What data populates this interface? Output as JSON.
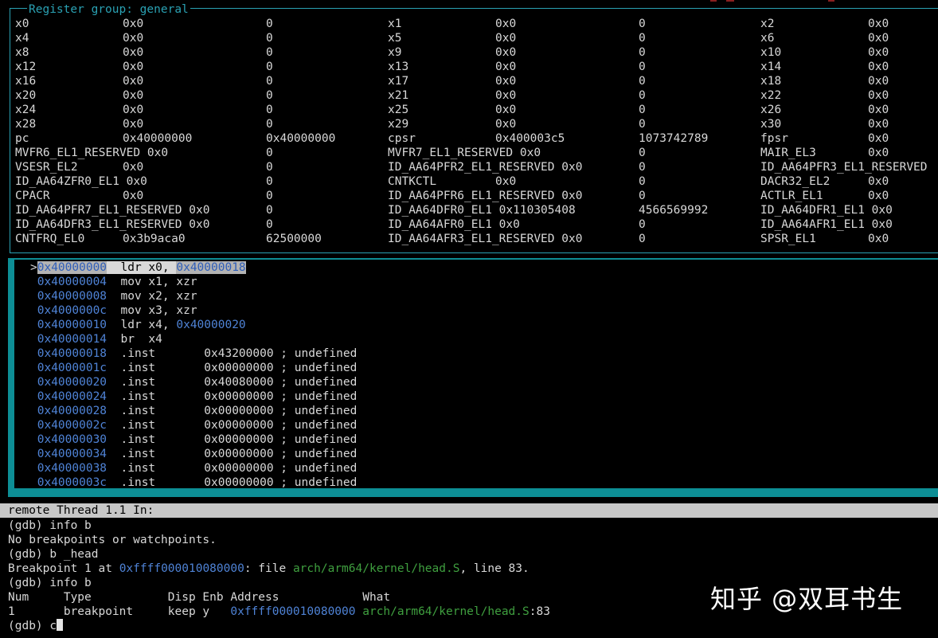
{
  "registers": {
    "title": "Register group: general",
    "rows": [
      [
        [
          "x0",
          "0x0",
          "0"
        ],
        [
          "x1",
          "0x0",
          "0"
        ],
        [
          "x2",
          "0x0",
          ""
        ]
      ],
      [
        [
          "x4",
          "0x0",
          "0"
        ],
        [
          "x5",
          "0x0",
          "0"
        ],
        [
          "x6",
          "0x0",
          ""
        ]
      ],
      [
        [
          "x8",
          "0x0",
          "0"
        ],
        [
          "x9",
          "0x0",
          "0"
        ],
        [
          "x10",
          "0x0",
          ""
        ]
      ],
      [
        [
          "x12",
          "0x0",
          "0"
        ],
        [
          "x13",
          "0x0",
          "0"
        ],
        [
          "x14",
          "0x0",
          ""
        ]
      ],
      [
        [
          "x16",
          "0x0",
          "0"
        ],
        [
          "x17",
          "0x0",
          "0"
        ],
        [
          "x18",
          "0x0",
          ""
        ]
      ],
      [
        [
          "x20",
          "0x0",
          "0"
        ],
        [
          "x21",
          "0x0",
          "0"
        ],
        [
          "x22",
          "0x0",
          ""
        ]
      ],
      [
        [
          "x24",
          "0x0",
          "0"
        ],
        [
          "x25",
          "0x0",
          "0"
        ],
        [
          "x26",
          "0x0",
          ""
        ]
      ],
      [
        [
          "x28",
          "0x0",
          "0"
        ],
        [
          "x29",
          "0x0",
          "0"
        ],
        [
          "x30",
          "0x0",
          ""
        ]
      ],
      [
        [
          "pc",
          "0x40000000",
          "0x40000000"
        ],
        [
          "cpsr",
          "0x400003c5",
          "1073742789"
        ],
        [
          "fpsr",
          "0x0",
          ""
        ]
      ],
      [
        [
          "MVFR6_EL1_RESERVED 0x0",
          "",
          "0"
        ],
        [
          "MVFR7_EL1_RESERVED 0x0",
          "",
          "0"
        ],
        [
          "MAIR_EL3",
          "0x0",
          ""
        ]
      ],
      [
        [
          "VSESR_EL2",
          "0x0",
          "0"
        ],
        [
          "ID_AA64PFR2_EL1_RESERVED 0x0",
          "",
          "0"
        ],
        [
          "ID_AA64PFR3_EL1_RESERVED",
          "",
          ""
        ]
      ],
      [
        [
          "ID_AA64ZFR0_EL1 0x0",
          "",
          "0"
        ],
        [
          "CNTKCTL",
          "0x0",
          "0"
        ],
        [
          "DACR32_EL2",
          "0x0",
          ""
        ]
      ],
      [
        [
          "CPACR",
          "0x0",
          "0"
        ],
        [
          "ID_AA64PFR6_EL1_RESERVED 0x0",
          "",
          "0"
        ],
        [
          "ACTLR_EL1",
          "0x0",
          ""
        ]
      ],
      [
        [
          "ID_AA64PFR7_EL1_RESERVED 0x0",
          "",
          "0"
        ],
        [
          "ID_AA64DFR0_EL1 0x110305408",
          "",
          "4566569992"
        ],
        [
          "ID_AA64DFR1_EL1 0x0",
          "",
          ""
        ]
      ],
      [
        [
          "ID_AA64DFR3_EL1_RESERVED 0x0",
          "",
          "0"
        ],
        [
          "ID_AA64AFR0_EL1 0x0",
          "",
          "0"
        ],
        [
          "ID_AA64AFR1_EL1 0x0",
          "",
          ""
        ]
      ],
      [
        [
          "CNTFRQ_EL0",
          "0x3b9aca0",
          "62500000"
        ],
        [
          "ID_AA64AFR3_EL1_RESERVED 0x0",
          "",
          "0"
        ],
        [
          "SPSR_EL1",
          "0x0",
          ""
        ]
      ]
    ]
  },
  "disassembly": {
    "current_marker": ">",
    "lines": [
      {
        "addr": "0x40000000",
        "ins": "ldr x0, ",
        "operand": "0x40000018",
        "current": true
      },
      {
        "addr": "0x40000004",
        "ins": "mov x1, xzr",
        "operand": ""
      },
      {
        "addr": "0x40000008",
        "ins": "mov x2, xzr",
        "operand": ""
      },
      {
        "addr": "0x4000000c",
        "ins": "mov x3, xzr",
        "operand": ""
      },
      {
        "addr": "0x40000010",
        "ins": "ldr x4, ",
        "operand": "0x40000020"
      },
      {
        "addr": "0x40000014",
        "ins": "br  x4",
        "operand": ""
      },
      {
        "addr": "0x40000018",
        "ins": ".inst       0x43200000 ; undefined",
        "operand": ""
      },
      {
        "addr": "0x4000001c",
        "ins": ".inst       0x00000000 ; undefined",
        "operand": ""
      },
      {
        "addr": "0x40000020",
        "ins": ".inst       0x40080000 ; undefined",
        "operand": ""
      },
      {
        "addr": "0x40000024",
        "ins": ".inst       0x00000000 ; undefined",
        "operand": ""
      },
      {
        "addr": "0x40000028",
        "ins": ".inst       0x00000000 ; undefined",
        "operand": ""
      },
      {
        "addr": "0x4000002c",
        "ins": ".inst       0x00000000 ; undefined",
        "operand": ""
      },
      {
        "addr": "0x40000030",
        "ins": ".inst       0x00000000 ; undefined",
        "operand": ""
      },
      {
        "addr": "0x40000034",
        "ins": ".inst       0x00000000 ; undefined",
        "operand": ""
      },
      {
        "addr": "0x40000038",
        "ins": ".inst       0x00000000 ; undefined",
        "operand": ""
      },
      {
        "addr": "0x4000003c",
        "ins": ".inst       0x00000000 ; undefined",
        "operand": ""
      }
    ]
  },
  "status_line": "remote Thread 1.1 In:",
  "console": {
    "l1": "(gdb) info b",
    "l2": "No breakpoints or watchpoints.",
    "l3": "(gdb) b _head",
    "l4_a": "Breakpoint 1 at ",
    "l4_addr": "0xffff000010080000",
    "l4_b": ": file ",
    "l4_file": "arch/arm64/kernel/head.S",
    "l4_c": ", line 83.",
    "l5": "(gdb) info b",
    "l6": "Num     Type           Disp Enb Address            What",
    "l7_a": "1       breakpoint     keep y   ",
    "l7_addr": "0xffff000010080000",
    "l7_b": " ",
    "l7_file": "arch/arm64/kernel/head.S",
    "l7_c": ":83",
    "prompt": "(gdb) c"
  },
  "watermark": "知乎 @双耳书生",
  "colors": {
    "panel_border": "#2aa1b3",
    "asm_frame": "#0d8e95",
    "address": "#4f83d6",
    "file": "#3f9f3f"
  }
}
